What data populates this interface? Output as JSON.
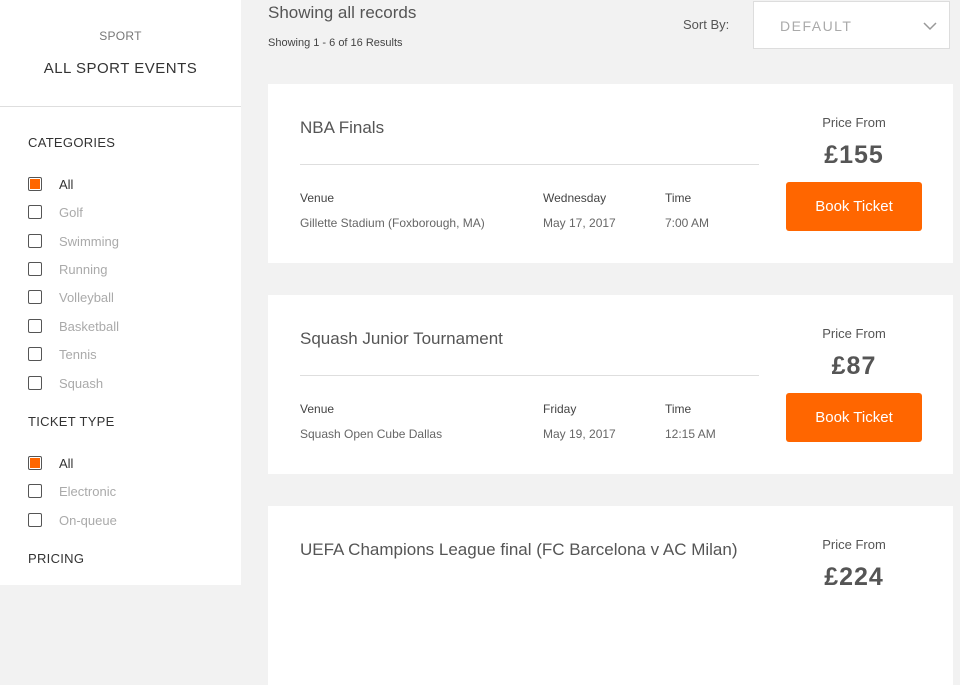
{
  "sidebar": {
    "sport_eyebrow": "SPORT",
    "sport_title": "ALL SPORT EVENTS",
    "categories_heading": "CATEGORIES",
    "categories": [
      {
        "label": "All",
        "checked": true
      },
      {
        "label": "Golf",
        "checked": false
      },
      {
        "label": "Swimming",
        "checked": false
      },
      {
        "label": "Running",
        "checked": false
      },
      {
        "label": "Volleyball",
        "checked": false
      },
      {
        "label": "Basketball",
        "checked": false
      },
      {
        "label": "Tennis",
        "checked": false
      },
      {
        "label": "Squash",
        "checked": false
      }
    ],
    "ticket_type_heading": "TICKET TYPE",
    "ticket_types": [
      {
        "label": "All",
        "checked": true
      },
      {
        "label": "Electronic",
        "checked": false
      },
      {
        "label": "On-queue",
        "checked": false
      }
    ],
    "pricing_heading": "PRICING"
  },
  "main": {
    "title": "Showing all records",
    "subtitle": "Showing 1 - 6 of 16 Results",
    "sort_label": "Sort By:",
    "sort_value": "DEFAULT",
    "sort_icon": "chevron-down-icon"
  },
  "events": [
    {
      "title": "NBA Finals",
      "venue_label": "Venue",
      "venue": "Gillette Stadium (Foxborough, MA)",
      "day": "Wednesday",
      "date": "May 17, 2017",
      "time_label": "Time",
      "time": "7:00 AM",
      "price_label": "Price From",
      "price": "£155",
      "button": "Book Ticket"
    },
    {
      "title": "Squash Junior Tournament",
      "venue_label": "Venue",
      "venue": "Squash Open Cube Dallas",
      "day": "Friday",
      "date": "May 19, 2017",
      "time_label": "Time",
      "time": "12:15 AM",
      "price_label": "Price From",
      "price": "£87",
      "button": "Book Ticket"
    },
    {
      "title": "UEFA Champions League final (FC Barcelona v AC Milan)",
      "price_label": "Price From",
      "price": "£224"
    }
  ],
  "colors": {
    "accent": "#ff6600",
    "background": "#f2f2f2",
    "card": "#ffffff"
  }
}
